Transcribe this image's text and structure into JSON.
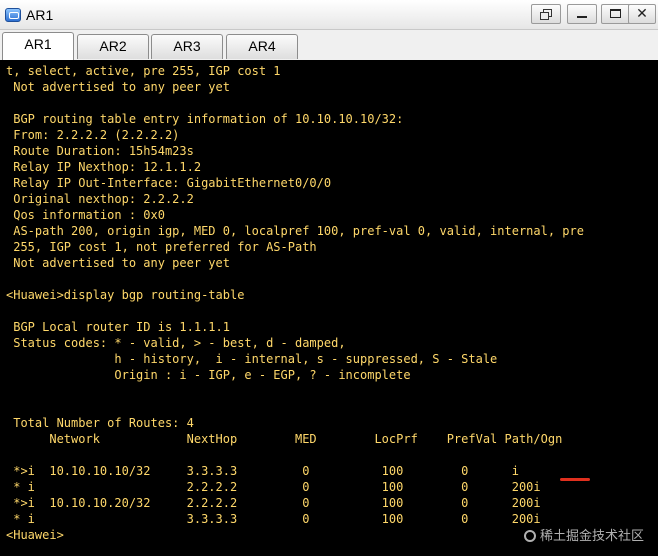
{
  "window": {
    "title": "AR1",
    "controls": [
      "restore-icon",
      "minimize-icon",
      "maximize-icon",
      "close-icon"
    ]
  },
  "tabs": [
    {
      "label": "AR1",
      "active": true
    },
    {
      "label": "AR2",
      "active": false
    },
    {
      "label": "AR3",
      "active": false
    },
    {
      "label": "AR4",
      "active": false
    }
  ],
  "terminal": {
    "text_color": "#ffd86a",
    "background": "#000000",
    "lines": [
      "t, select, active, pre 255, IGP cost 1",
      " Not advertised to any peer yet",
      "",
      " BGP routing table entry information of 10.10.10.10/32:",
      " From: 2.2.2.2 (2.2.2.2)",
      " Route Duration: 15h54m23s",
      " Relay IP Nexthop: 12.1.1.2",
      " Relay IP Out-Interface: GigabitEthernet0/0/0",
      " Original nexthop: 2.2.2.2",
      " Qos information : 0x0",
      " AS-path 200, origin igp, MED 0, localpref 100, pref-val 0, valid, internal, pre",
      " 255, IGP cost 1, not preferred for AS-Path",
      " Not advertised to any peer yet",
      "",
      "<Huawei>display bgp routing-table",
      "",
      " BGP Local router ID is 1.1.1.1",
      " Status codes: * - valid, > - best, d - damped,",
      "               h - history,  i - internal, s - suppressed, S - Stale",
      "               Origin : i - IGP, e - EGP, ? - incomplete",
      "",
      "",
      " Total Number of Routes: 4",
      "      Network            NextHop        MED        LocPrf    PrefVal Path/Ogn",
      "",
      " *>i  10.10.10.10/32     3.3.3.3         0          100        0      i",
      " * i                     2.2.2.2         0          100        0      200i",
      " *>i  10.10.10.20/32     2.2.2.2         0          100        0      200i",
      " * i                     3.3.3.3         0          100        0      200i",
      "<Huawei>"
    ]
  },
  "annotation": {
    "color": "#e0301e"
  },
  "watermark": {
    "text": "稀土掘金技术社区"
  }
}
